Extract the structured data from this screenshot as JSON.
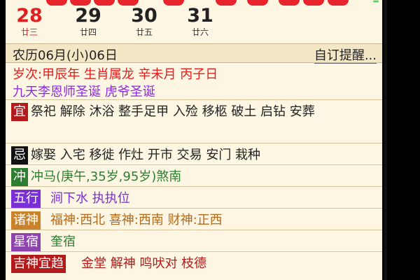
{
  "calendar": {
    "days": [
      {
        "day": "28",
        "lunar": "廿三",
        "highlight": true
      },
      {
        "day": "29",
        "lunar": "廿四",
        "highlight": false
      },
      {
        "day": "30",
        "lunar": "廿五",
        "highlight": false
      },
      {
        "day": "31",
        "lunar": "廿六",
        "highlight": false
      }
    ]
  },
  "info": {
    "lunar_date": "农历06月(小)06日",
    "custom_reminder": "自订提醒...",
    "suici": "岁次:甲辰年 生肖属龙 辛未月 丙子日",
    "holidays": "九天李恩师圣诞 虎爷圣诞"
  },
  "almanac": {
    "yi": {
      "label": "宜",
      "text": "祭祀 解除 沐浴 整手足甲 入殓 移柩 破土 启钻 安葬",
      "color": "#b31b1b"
    },
    "ji": {
      "label": "忌",
      "text": "嫁娶 入宅 移徙 作灶 开市 交易 安门 栽种",
      "color": "#111111"
    },
    "chong": {
      "label": "冲",
      "text": "冲马(庚午,35岁,95岁)煞南",
      "color": "#2e7d32"
    },
    "wuxing": {
      "label": "五行",
      "text": "涧下水 执执位",
      "color": "#7b2fd6"
    },
    "zhushen": {
      "label": "诸神",
      "text": "福神:西北 喜神:西南 财神:正西",
      "color": "#c9822a"
    },
    "xingxiu": {
      "label": "星宿",
      "text": "奎宿",
      "color": "#8e44ad"
    },
    "jishen": {
      "label": "吉神宜趋",
      "text": "金堂 解神 鸣吠对 枝德",
      "color": "#b31b1b"
    }
  }
}
